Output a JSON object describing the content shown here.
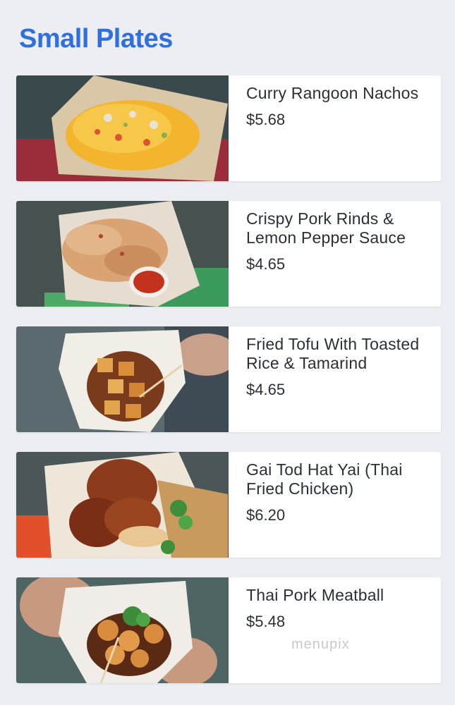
{
  "section": {
    "title": "Small Plates"
  },
  "items": [
    {
      "name": "Curry Rangoon Nachos",
      "price": "$5.68",
      "photo_icon": "nachos-photo"
    },
    {
      "name": "Crispy Pork Rinds & Lemon Pepper Sauce",
      "price": "$4.65",
      "photo_icon": "pork-rinds-photo"
    },
    {
      "name": "Fried Tofu With Toasted Rice & Tamarind",
      "price": "$4.65",
      "photo_icon": "fried-tofu-photo"
    },
    {
      "name": "Gai Tod Hat Yai (Thai Fried Chicken)",
      "price": "$6.20",
      "photo_icon": "fried-chicken-photo"
    },
    {
      "name": "Thai Pork Meatball",
      "price": "$5.48",
      "photo_icon": "meatball-photo"
    }
  ],
  "watermark": "menupix",
  "colors": {
    "title": "#2f6fde",
    "background": "#eceef3",
    "card": "#ffffff",
    "text": "#2b2f36"
  }
}
